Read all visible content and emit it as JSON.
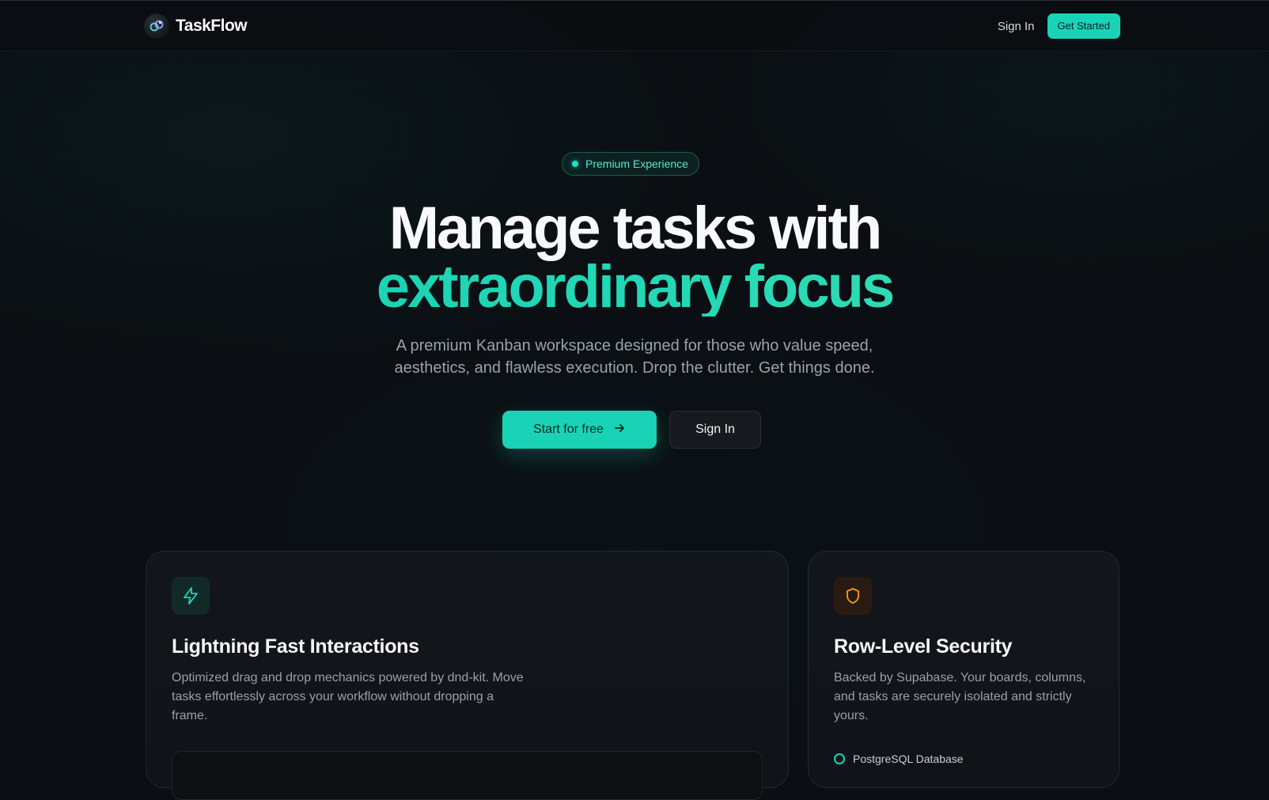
{
  "header": {
    "brand": "TaskFlow",
    "nav_signin": "Sign In",
    "nav_cta": "Get Started"
  },
  "hero": {
    "badge": "Premium Experience",
    "title_line1": "Manage tasks with",
    "title_line2": "extraordinary focus",
    "subtitle": "A premium Kanban workspace designed for those who value speed, aesthetics, and flawless execution. Drop the clutter. Get things done.",
    "primary_button": "Start for free",
    "secondary_button": "Sign In"
  },
  "features": [
    {
      "icon": "lightning-icon",
      "title": "Lightning Fast Interactions",
      "description": "Optimized drag and drop mechanics powered by dnd-kit. Move tasks effortlessly across your workflow without dropping a frame."
    },
    {
      "icon": "shield-icon",
      "title": "Row-Level Security",
      "description": "Backed by Supabase. Your boards, columns, and tasks are securely isolated and strictly yours.",
      "list_items": [
        "PostgreSQL Database"
      ]
    }
  ],
  "colors": {
    "accent": "#19d3b8",
    "background": "#0b0e12",
    "security_accent": "#f59e2b"
  }
}
